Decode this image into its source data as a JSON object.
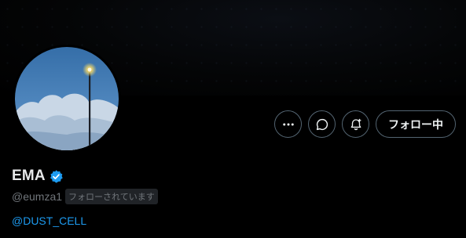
{
  "profile": {
    "display_name": "EMA",
    "handle": "@eumza1",
    "follows_you_badge": "フォローされています",
    "bio_link": "@DUST_CELL",
    "verified": true
  },
  "actions": {
    "more_icon": "more-horizontal-icon",
    "message_icon": "message-bubble-icon",
    "notify_icon": "bell-plus-icon",
    "follow_label": "フォロー中"
  },
  "colors": {
    "background": "#000000",
    "accent": "#1d9bf0",
    "secondary_text": "#71767b",
    "border": "#536471"
  }
}
